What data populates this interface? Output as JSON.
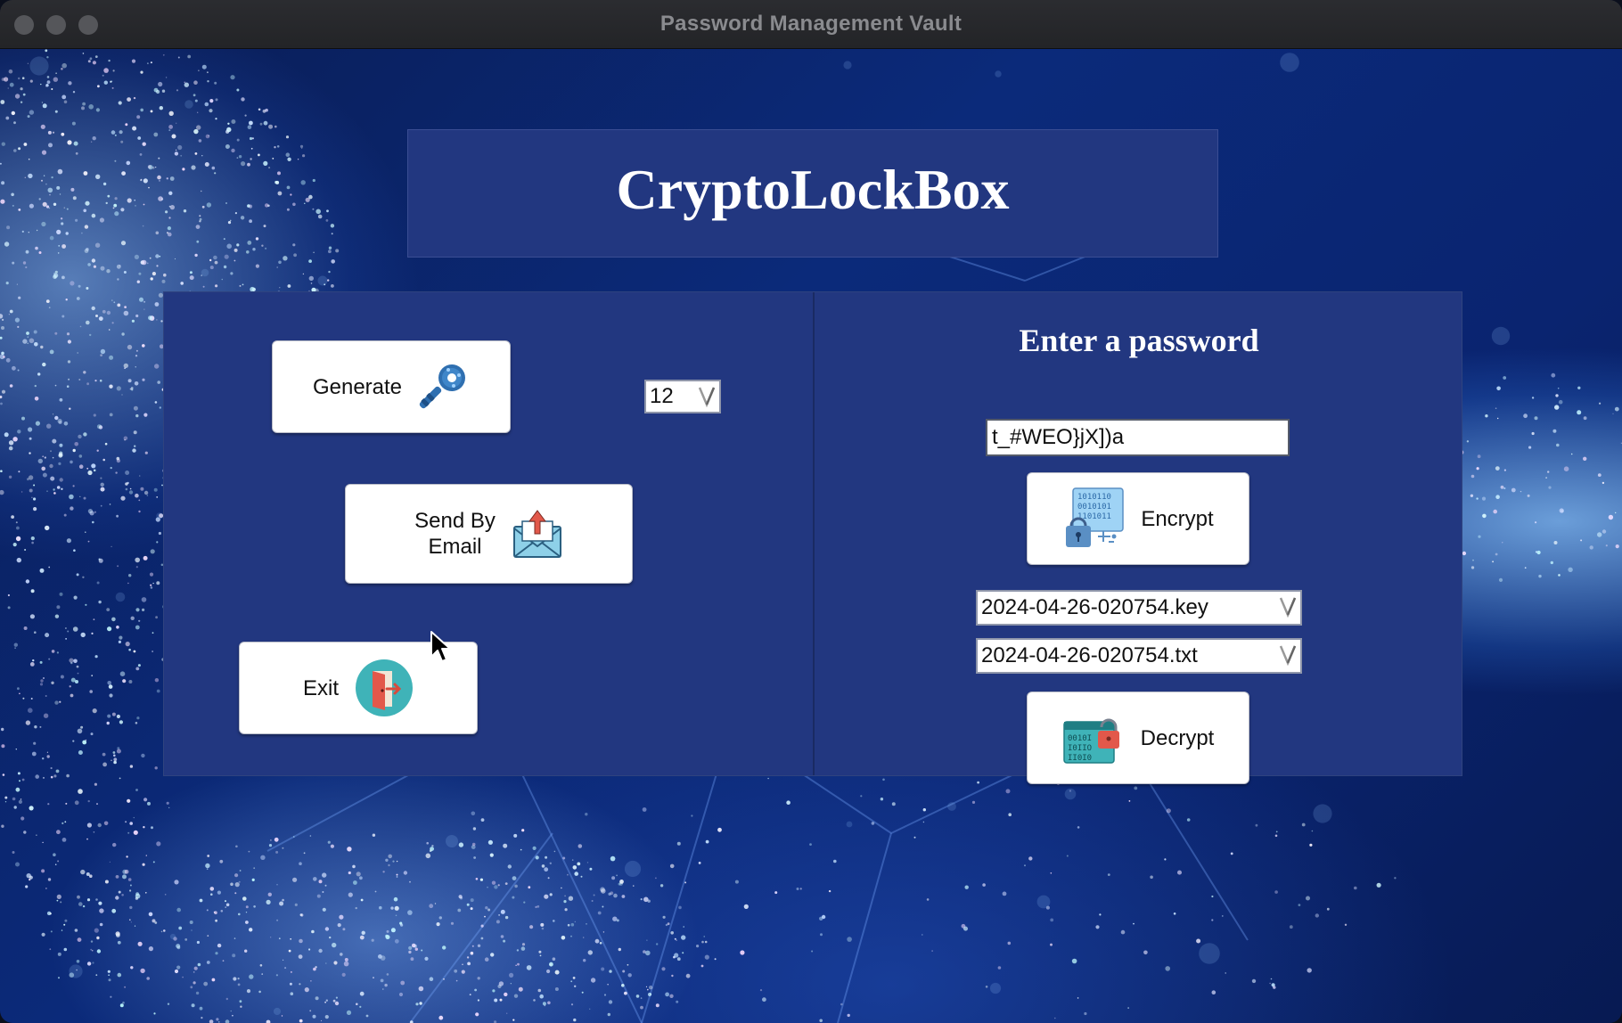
{
  "window": {
    "title": "Password Management Vault"
  },
  "app": {
    "title": "CryptoLockBox"
  },
  "left_panel": {
    "generate_label": "Generate",
    "length_value": "12",
    "send_email_label": "Send By\nEmail",
    "exit_label": "Exit"
  },
  "right_panel": {
    "heading": "Enter a password",
    "password_value": "t_#WEO}jX])a",
    "encrypt_label": "Encrypt",
    "key_file": "2024-04-26-020754.key",
    "txt_file": "2024-04-26-020754.txt",
    "decrypt_label": "Decrypt"
  },
  "icons": {
    "generate": "key-icon",
    "send_email": "envelope-upload-icon",
    "exit": "exit-door-icon",
    "encrypt": "binary-lock-icon",
    "decrypt": "binary-unlock-icon",
    "dropdown": "chevron-down-icon"
  },
  "colors": {
    "panel": "#223780",
    "title_bar": "#2b2c30",
    "button_bg": "#ffffff"
  }
}
